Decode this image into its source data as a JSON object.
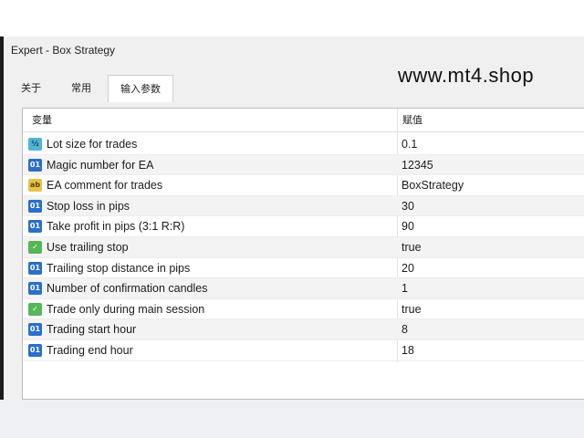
{
  "window": {
    "title": "Expert - Box Strategy"
  },
  "watermark": "www.mt4.shop",
  "tabs": [
    {
      "label": "关于"
    },
    {
      "label": "常用"
    },
    {
      "label": "输入参数",
      "active": true
    }
  ],
  "table": {
    "headers": {
      "variable": "变量",
      "value": "赋值"
    },
    "rows": [
      {
        "icon": "double-type-icon",
        "badge": "½",
        "name": "Lot size for trades",
        "value": "0.1"
      },
      {
        "icon": "integer-type-icon",
        "badge": "01",
        "name": "Magic number for EA",
        "value": "12345"
      },
      {
        "icon": "string-type-icon",
        "badge": "ab",
        "name": "EA comment for trades",
        "value": "BoxStrategy"
      },
      {
        "icon": "integer-type-icon",
        "badge": "01",
        "name": "Stop loss in pips",
        "value": "30"
      },
      {
        "icon": "integer-type-icon",
        "badge": "01",
        "name": "Take profit in pips (3:1 R:R)",
        "value": "90"
      },
      {
        "icon": "boolean-type-icon",
        "badge": "✓",
        "name": "Use trailing stop",
        "value": "true"
      },
      {
        "icon": "integer-type-icon",
        "badge": "01",
        "name": "Trailing stop distance in pips",
        "value": "20"
      },
      {
        "icon": "integer-type-icon",
        "badge": "01",
        "name": "Number of confirmation candles",
        "value": "1"
      },
      {
        "icon": "boolean-type-icon",
        "badge": "✓",
        "name": "Trade only during main session",
        "value": "true"
      },
      {
        "icon": "integer-type-icon",
        "badge": "01",
        "name": "Trading start hour",
        "value": "8"
      },
      {
        "icon": "integer-type-icon",
        "badge": "01",
        "name": "Trading end hour",
        "value": "18"
      }
    ]
  },
  "colors": {
    "integer_icon": "#2a6fc9",
    "double_icon": "#4fb4d8",
    "string_icon": "#e7c34b",
    "boolean_icon": "#56b65a"
  }
}
